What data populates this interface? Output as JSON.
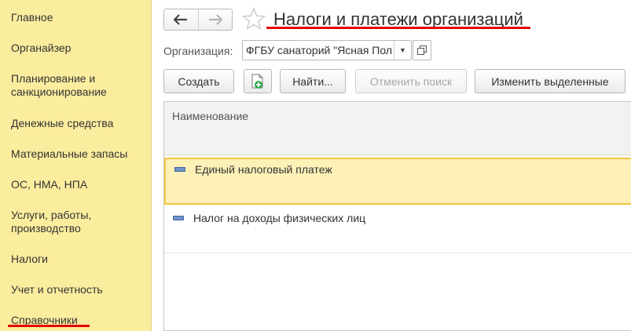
{
  "sidebar": {
    "items": [
      {
        "label": "Главное"
      },
      {
        "label": "Органайзер"
      },
      {
        "label": "Планирование и санкционирование"
      },
      {
        "label": "Денежные средства"
      },
      {
        "label": "Материальные запасы"
      },
      {
        "label": "ОС, НМА, НПА"
      },
      {
        "label": "Услуги, работы, производство"
      },
      {
        "label": "Налоги"
      },
      {
        "label": "Учет и отчетность"
      },
      {
        "label": "Справочники"
      }
    ],
    "active_item": "Справочники"
  },
  "header": {
    "title": "Налоги и платежи организаций",
    "back_icon": "arrow-left-icon",
    "forward_icon": "arrow-right-icon",
    "favorite_icon": "star-icon"
  },
  "organization": {
    "label": "Организация:",
    "value": "ФГБУ санаторий \"Ясная Пол"
  },
  "toolbar": {
    "create_label": "Создать",
    "add_copy_icon": "add-document-icon",
    "find_label": "Найти...",
    "cancel_search_label": "Отменить поиск",
    "edit_selected_label": "Изменить выделенные"
  },
  "table": {
    "columns": [
      "Наименование"
    ],
    "rows": [
      {
        "name": "Единый налоговый платеж",
        "selected": true
      },
      {
        "name": "Налог на доходы физических лиц",
        "selected": false
      }
    ]
  },
  "colors": {
    "sidebar_bg": "#fbed9e",
    "accent_red": "#e00000",
    "selection_border": "#f4c542"
  }
}
